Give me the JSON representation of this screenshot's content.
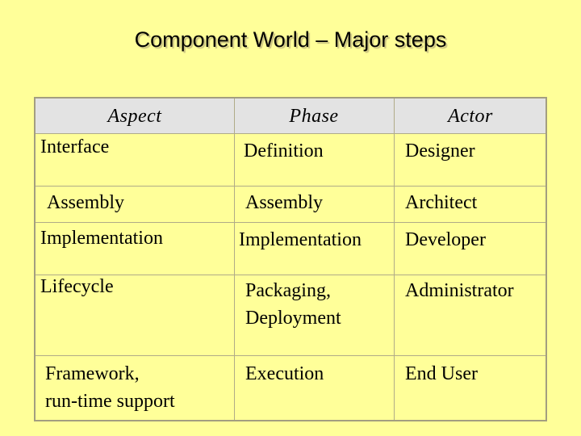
{
  "slide": {
    "title": "Component World – Major steps"
  },
  "table": {
    "headers": [
      "Aspect",
      "Phase",
      "Actor"
    ],
    "rows": [
      {
        "aspect": "Interface",
        "phase": "Definition",
        "actor": "Designer"
      },
      {
        "aspect": "Assembly",
        "phase": "Assembly",
        "actor": "Architect"
      },
      {
        "aspect": "Implementation",
        "phase": "Implementation",
        "actor": "Developer"
      },
      {
        "aspect": "Lifecycle",
        "phase": [
          "Packaging,",
          "Deployment"
        ],
        "actor": "Administrator"
      },
      {
        "aspect": [
          "Framework,",
          "run-time support"
        ],
        "phase": "Execution",
        "actor": "End User"
      }
    ]
  },
  "colors": {
    "background": "#ffff99",
    "header_fill": "#e3e3e3",
    "border": "#a39e80"
  }
}
